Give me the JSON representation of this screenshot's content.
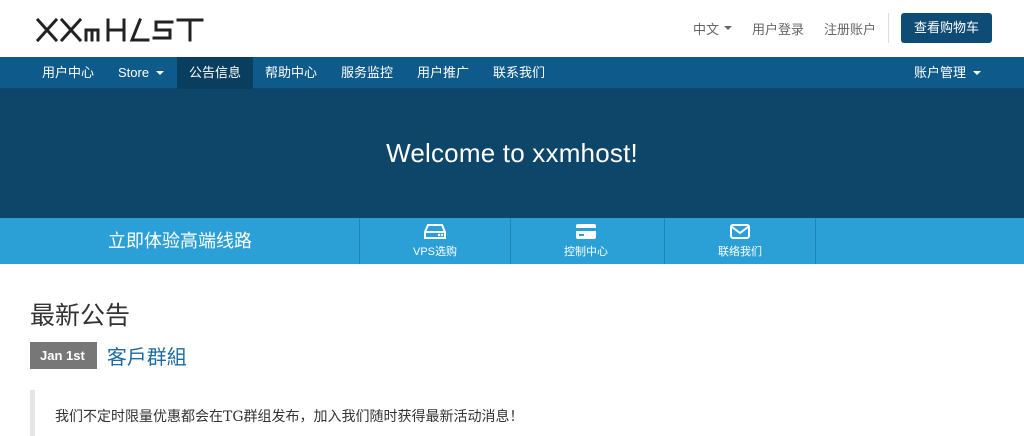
{
  "header": {
    "logo_text": "XXmHOST",
    "language": "中文",
    "login": "用户登录",
    "register": "注册账户",
    "cart": "查看购物车"
  },
  "nav": {
    "items": [
      {
        "label": "用户中心"
      },
      {
        "label": "Store"
      },
      {
        "label": "公告信息"
      },
      {
        "label": "帮助中心"
      },
      {
        "label": "服务监控"
      },
      {
        "label": "用户推广"
      },
      {
        "label": "联系我们"
      }
    ],
    "account": "账户管理",
    "active_index": 2
  },
  "hero": {
    "title": "Welcome to xxmhost!"
  },
  "quick": {
    "slogan": "立即体验高端线路",
    "links": [
      {
        "label": "VPS选购",
        "icon": "server-icon"
      },
      {
        "label": "控制中心",
        "icon": "credit-card-icon"
      },
      {
        "label": "联络我们",
        "icon": "envelope-icon"
      }
    ]
  },
  "content": {
    "title": "最新公告",
    "announcement": {
      "date": "Jan 1st",
      "title": "客戶群組",
      "body": "我们不定时限量优惠都会在TG群组发布，加入我们随时获得最新活动消息！"
    }
  },
  "colors": {
    "brand_dark": "#0f4c75",
    "nav": "#0e5a8a",
    "hero": "#0d4668",
    "quick": "#2ba0d6",
    "link": "#1c6aa0"
  }
}
